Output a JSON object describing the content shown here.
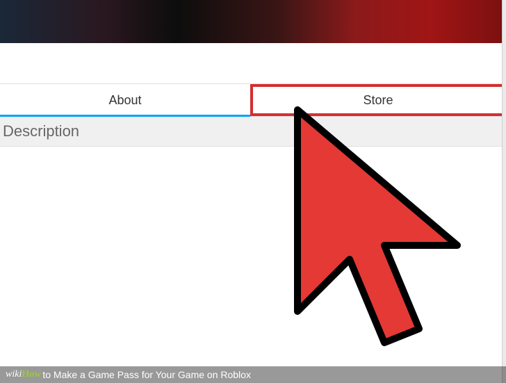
{
  "tabs": {
    "about": "About",
    "store": "Store"
  },
  "section": {
    "title": "Description"
  },
  "caption": {
    "brand_prefix": "wiki",
    "brand_suffix": "How",
    "text": " to Make a Game Pass for Your Game on Roblox"
  }
}
